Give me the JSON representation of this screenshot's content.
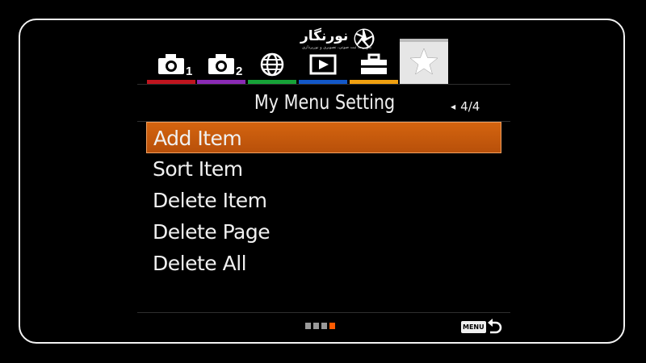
{
  "watermark": {
    "name": "نورنگار",
    "subtitle": "تجهیزات ثبت صوتی، تصویری و نورپردازی"
  },
  "tabs": [
    {
      "icon": "camera-icon",
      "sub": "1",
      "color": "#c0141e"
    },
    {
      "icon": "camera-icon",
      "sub": "2",
      "color": "#8a2ab5"
    },
    {
      "icon": "globe-icon",
      "sub": "",
      "color": "#16a238"
    },
    {
      "icon": "playback-icon",
      "sub": "",
      "color": "#1257c8"
    },
    {
      "icon": "toolbox-icon",
      "sub": "",
      "color": "#f0a010"
    },
    {
      "icon": "star-icon",
      "sub": "",
      "color": "#e6e6e6",
      "active": true
    }
  ],
  "header": {
    "title": "My Menu Setting",
    "page": "4/4"
  },
  "menu": {
    "items": [
      {
        "label": "Add Item",
        "selected": true
      },
      {
        "label": "Sort Item"
      },
      {
        "label": "Delete Item"
      },
      {
        "label": "Delete Page"
      },
      {
        "label": "Delete All"
      }
    ]
  },
  "footer": {
    "pages": 4,
    "current_page": 4,
    "active_color": "#ff5a00",
    "menu_label": "MENU",
    "back_icon": "back-arrow-icon"
  }
}
